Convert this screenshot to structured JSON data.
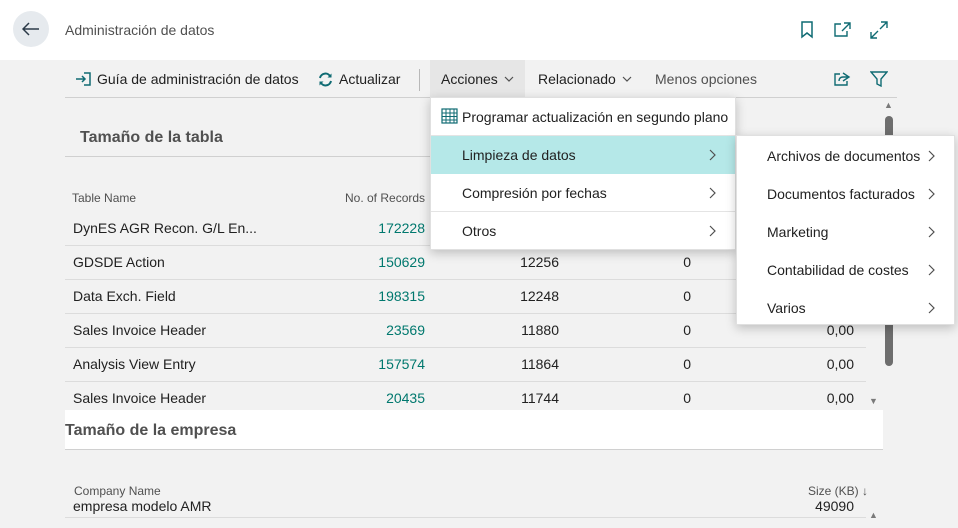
{
  "header": {
    "title": "Administración de datos"
  },
  "actionbar": {
    "guide": "Guía de administración de datos",
    "refresh": "Actualizar",
    "actions": "Acciones",
    "related": "Relacionado",
    "fewer": "Menos opciones"
  },
  "table_section": {
    "title": "Tamaño de la tabla",
    "col_name": "Table Name",
    "col_records": "No. of Records",
    "rows": [
      {
        "name": "DynES AGR Recon. G/L En...",
        "records": "172228",
        "a": "",
        "b": "",
        "c": ""
      },
      {
        "name": "GDSDE Action",
        "records": "150629",
        "a": "12256",
        "b": "0",
        "c": ""
      },
      {
        "name": "Data Exch. Field",
        "records": "198315",
        "a": "12248",
        "b": "0",
        "c": ""
      },
      {
        "name": "Sales Invoice Header",
        "records": "23569",
        "a": "11880",
        "b": "0",
        "c": "0,00"
      },
      {
        "name": "Analysis View Entry",
        "records": "157574",
        "a": "11864",
        "b": "0",
        "c": "0,00"
      },
      {
        "name": "Sales Invoice Header",
        "records": "20435",
        "a": "11744",
        "b": "0",
        "c": "0,00"
      }
    ]
  },
  "company_section": {
    "title": "Tamaño de la empresa",
    "col_name": "Company Name",
    "col_size": "Size (KB) ↓",
    "partial_row_name": "empresa modelo AMR",
    "partial_row_size": "49090"
  },
  "actions_menu": {
    "items": [
      {
        "label": "Programar actualización en segundo plano",
        "has_sub": false
      },
      {
        "label": "Limpieza de datos",
        "has_sub": true
      },
      {
        "label": "Compresión por fechas",
        "has_sub": true
      },
      {
        "label": "Otros",
        "has_sub": true
      }
    ]
  },
  "submenu": {
    "items": [
      {
        "label": "Archivos de documentos"
      },
      {
        "label": "Documentos facturados"
      },
      {
        "label": "Marketing"
      },
      {
        "label": "Contabilidad de costes"
      },
      {
        "label": "Varios"
      }
    ]
  },
  "colors": {
    "accent": "#00786e",
    "menu_selected": "#b5e8e8",
    "icon": "#0f6b73"
  }
}
